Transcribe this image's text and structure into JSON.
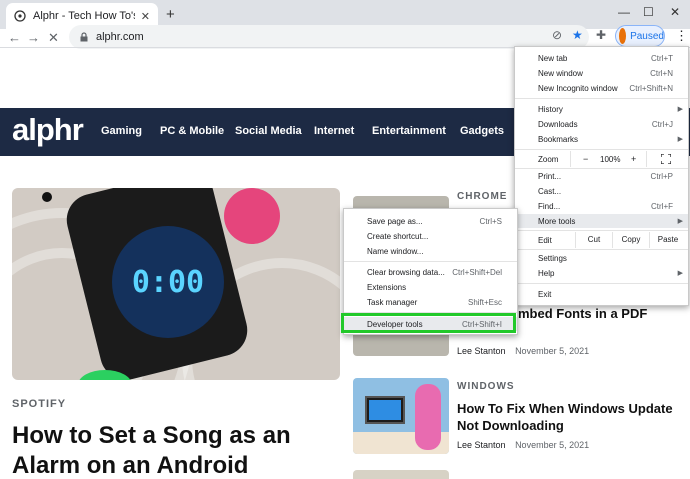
{
  "browser": {
    "tab_title": "Alphr - Tech How To's & Guides",
    "url": "alphr.com",
    "profile_label": "Paused"
  },
  "site": {
    "logo": "alphr",
    "nav_items": [
      "Gaming",
      "PC & Mobile",
      "Social Media",
      "Internet",
      "Entertainment",
      "Gadgets"
    ],
    "left_article": {
      "category": "SPOTIFY",
      "headline": "How to Set a Song as an Alarm on an Android",
      "clock_text": "0:00"
    },
    "right_articles": [
      {
        "category": "CHROME",
        "headline_fragment": "mbed Fonts in a PDF",
        "author": "Lee Stanton",
        "date": "November 5, 2021"
      },
      {
        "category": "WINDOWS",
        "headline": "How To Fix When Windows Update Not Downloading",
        "author": "Lee Stanton",
        "date": "November 5, 2021"
      }
    ]
  },
  "menu": {
    "new_tab": {
      "label": "New tab",
      "shortcut": "Ctrl+T"
    },
    "new_window": {
      "label": "New window",
      "shortcut": "Ctrl+N"
    },
    "new_incognito": {
      "label": "New Incognito window",
      "shortcut": "Ctrl+Shift+N"
    },
    "history": {
      "label": "History"
    },
    "downloads": {
      "label": "Downloads",
      "shortcut": "Ctrl+J"
    },
    "bookmarks": {
      "label": "Bookmarks"
    },
    "zoom": {
      "label": "Zoom",
      "minus": "−",
      "value": "100%",
      "plus": "+"
    },
    "print": {
      "label": "Print...",
      "shortcut": "Ctrl+P"
    },
    "cast": {
      "label": "Cast..."
    },
    "find": {
      "label": "Find...",
      "shortcut": "Ctrl+F"
    },
    "more_tools": {
      "label": "More tools"
    },
    "edit": {
      "label": "Edit",
      "cut": "Cut",
      "copy": "Copy",
      "paste": "Paste"
    },
    "settings": {
      "label": "Settings"
    },
    "help": {
      "label": "Help"
    },
    "exit": {
      "label": "Exit"
    }
  },
  "submenu": {
    "save_page": {
      "label": "Save page as...",
      "shortcut": "Ctrl+S"
    },
    "create_shortcut": {
      "label": "Create shortcut..."
    },
    "name_window": {
      "label": "Name window..."
    },
    "clear_data": {
      "label": "Clear browsing data...",
      "shortcut": "Ctrl+Shift+Del"
    },
    "extensions": {
      "label": "Extensions"
    },
    "task_manager": {
      "label": "Task manager",
      "shortcut": "Shift+Esc"
    },
    "developer_tools": {
      "label": "Developer tools",
      "shortcut": "Ctrl+Shift+I"
    }
  },
  "colors": {
    "nav_bg": "#1d2a44",
    "highlight": "#22c92a",
    "accent_blue": "#1a73e8"
  }
}
